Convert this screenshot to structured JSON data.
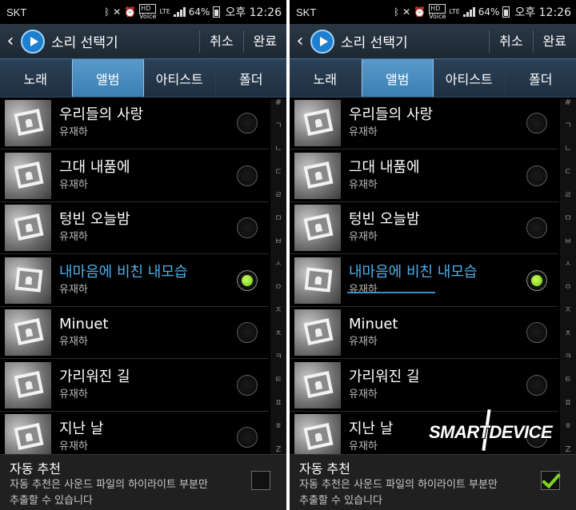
{
  "status": {
    "carrier": "SKT",
    "hd": "HD",
    "voice": "Voice",
    "lte": "LTE",
    "battery": "64%",
    "time": "오후 12:26"
  },
  "actionbar": {
    "back_icon": "back-arrow-icon",
    "title": "소리 선택기",
    "cancel": "취소",
    "done": "완료"
  },
  "tabs": [
    "노래",
    "앨범",
    "아티스트",
    "폴더"
  ],
  "active_tab": "앨범",
  "items": [
    {
      "title": "우리들의 사랑",
      "artist": "유재하"
    },
    {
      "title": "그대 내품에",
      "artist": "유재하"
    },
    {
      "title": "텅빈 오늘밤",
      "artist": "유재하"
    },
    {
      "title": "내마음에 비친 내모습",
      "artist": "유재하",
      "selected": true
    },
    {
      "title": "Minuet",
      "artist": "유재하"
    },
    {
      "title": "가리워진 길",
      "artist": "유재하"
    },
    {
      "title": "지난 날",
      "artist": "유재하"
    }
  ],
  "index": [
    "#",
    "ㄱ",
    "ㄴ",
    "ㄷ",
    "ㄹ",
    "ㅁ",
    "ㅂ",
    "ㅅ",
    "ㅇ",
    "ㅈ",
    "ㅊ",
    "ㅋ",
    "ㅌ",
    "ㅍ",
    "ㅎ",
    "Z"
  ],
  "auto_recommend": {
    "title": "자동 추천",
    "desc_line1": "자동 추천은 사운드 파일의 하이라이트 부분만",
    "desc_line2": "추출할 수 있습니다",
    "left_checked": false,
    "right_checked": true
  },
  "watermark": "SMARTDEVICE",
  "colors": {
    "accent": "#4fb0ea",
    "tab_active": "#4a8bbf",
    "check": "#7ed321"
  }
}
